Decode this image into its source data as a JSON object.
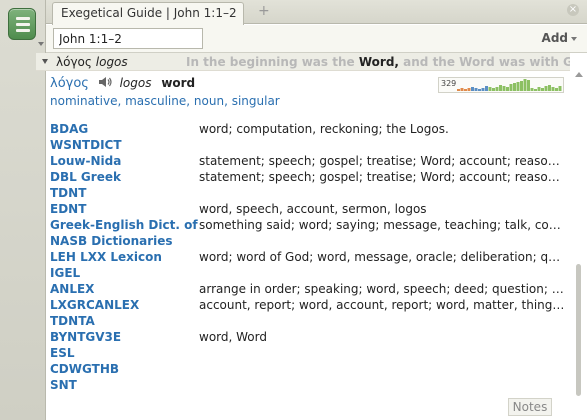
{
  "tab": {
    "title": "Exegetical Guide | John 1:1–2",
    "add": "+",
    "close": "×"
  },
  "toolbar": {
    "reference": "John 1:1–2",
    "add_label": "Add"
  },
  "section": {
    "word_greek": "λόγος",
    "word_translit": "logos",
    "verse_before": "In the beginning was the",
    "verse_word": "Word,",
    "verse_after": "and the Word was with God, and th"
  },
  "lemma": {
    "greek": "λόγος",
    "translit": "logos",
    "gloss": "word",
    "frequency_count": "329",
    "morph": [
      "nominative",
      "masculine",
      "noun",
      "singular"
    ]
  },
  "lexicons": [
    {
      "name": "BDAG",
      "def": "word; computation, reckoning; the Logos."
    },
    {
      "name": "WSNTDICT",
      "def": ""
    },
    {
      "name": "Louw-Nida",
      "def": "statement; speech; gospel; treatise; Word; account; reason; eve..."
    },
    {
      "name": "DBL Greek",
      "def": "statement; speech; gospel; treatise; Word; account; reason; eve..."
    },
    {
      "name": "TDNT",
      "def": ""
    },
    {
      "name": "EDNT",
      "def": "word, speech, account, sermon, logos"
    },
    {
      "name": "Greek-English Dict. of N.T.",
      "def": "something said; word; saying; message, teaching; talk, conversat..."
    },
    {
      "name": "NASB Dictionaries",
      "def": ""
    },
    {
      "name": "LEH LXX Lexicon",
      "def": "word; word of God; word, message, oracle; deliberation; questio..."
    },
    {
      "name": "IGEL",
      "def": ""
    },
    {
      "name": "ANLEX",
      "def": "arrange in order; speaking; word, speech; deed; question; proph..."
    },
    {
      "name": "LXGRCANLEX",
      "def": "account, report; word, account, report; word, matter, thing; wor..."
    },
    {
      "name": "TDNTA",
      "def": ""
    },
    {
      "name": "BYNTGV3E",
      "def": "word, Word"
    },
    {
      "name": "ESL",
      "def": ""
    },
    {
      "name": "CDWGTHB",
      "def": ""
    },
    {
      "name": "SNT",
      "def": ""
    }
  ],
  "notes_label": "Notes",
  "colors": {
    "link": "#2a6fb0",
    "accent_green": "#5c9a59",
    "freq_bar_green": "#8cc063",
    "freq_bar_orange": "#e08a4a",
    "freq_bar_blue": "#5b8fc4"
  }
}
